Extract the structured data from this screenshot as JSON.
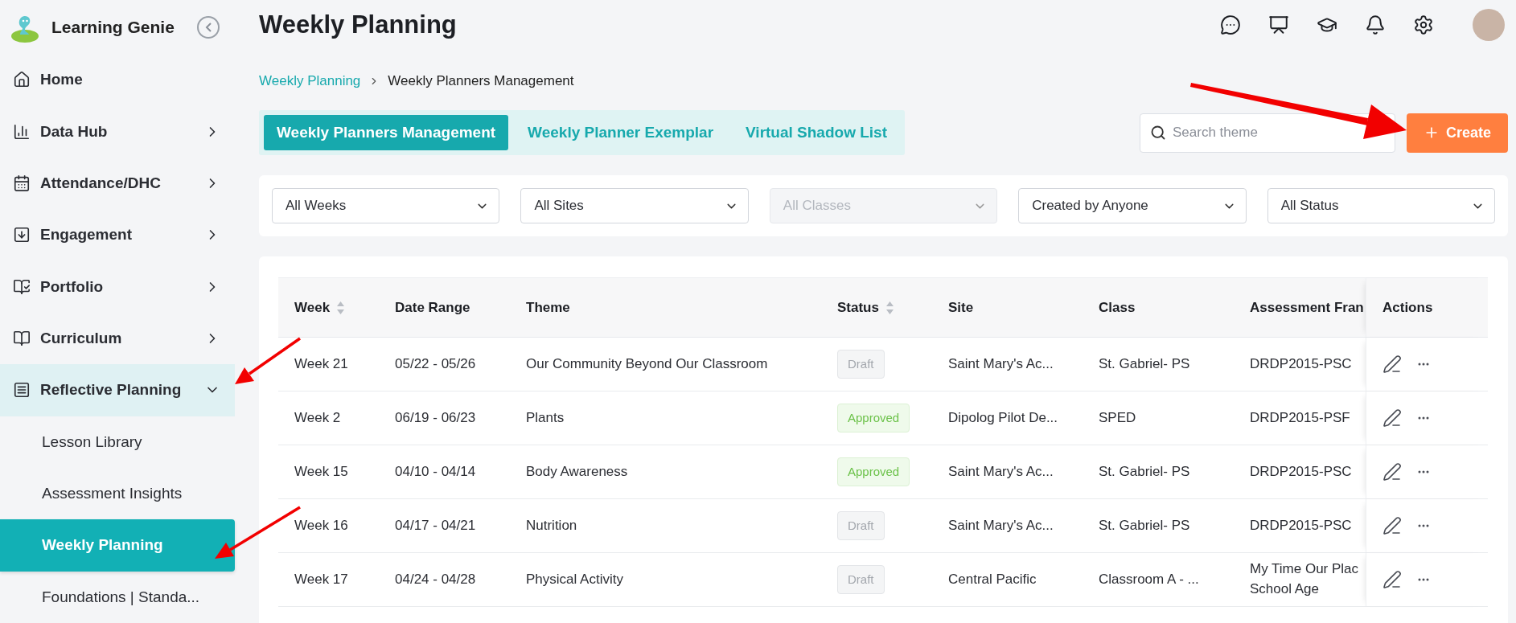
{
  "app": {
    "name": "Learning Genie"
  },
  "sidebar": {
    "items": [
      {
        "label": "Home",
        "kind": "link",
        "selected": false
      },
      {
        "label": "Data Hub",
        "kind": "group",
        "expanded": false
      },
      {
        "label": "Attendance/DHC",
        "kind": "group",
        "expanded": false
      },
      {
        "label": "Engagement",
        "kind": "group",
        "expanded": false
      },
      {
        "label": "Portfolio",
        "kind": "group",
        "expanded": false
      },
      {
        "label": "Curriculum",
        "kind": "group",
        "expanded": false
      },
      {
        "label": "Reflective Planning",
        "kind": "group",
        "expanded": true,
        "children": [
          {
            "label": "Lesson Library",
            "selected": false
          },
          {
            "label": "Assessment Insights",
            "selected": false
          },
          {
            "label": "Weekly Planning",
            "selected": true
          },
          {
            "label": "Foundations | Standa...",
            "selected": false
          }
        ]
      }
    ]
  },
  "page": {
    "title": "Weekly Planning"
  },
  "breadcrumb": [
    {
      "label": "Weekly Planning",
      "kind": "link"
    },
    {
      "label": "Weekly Planners Management",
      "kind": "current"
    }
  ],
  "tabs": [
    {
      "label": "Weekly Planners Management",
      "selected": true
    },
    {
      "label": "Weekly Planner Exemplar",
      "selected": false
    },
    {
      "label": "Virtual Shadow List",
      "selected": false
    }
  ],
  "search": {
    "placeholder": "Search theme"
  },
  "create_button": {
    "label": "Create"
  },
  "filters": [
    {
      "label": "All Weeks",
      "disabled": false
    },
    {
      "label": "All Sites",
      "disabled": false
    },
    {
      "label": "All Classes",
      "disabled": true
    },
    {
      "label": "Created by Anyone",
      "disabled": false
    },
    {
      "label": "All Status",
      "disabled": false
    }
  ],
  "table": {
    "columns": [
      {
        "label": "Week",
        "sortable": true
      },
      {
        "label": "Date Range",
        "sortable": false
      },
      {
        "label": "Theme",
        "sortable": false
      },
      {
        "label": "Status",
        "sortable": true
      },
      {
        "label": "Site",
        "sortable": false
      },
      {
        "label": "Class",
        "sortable": false
      },
      {
        "label": "Assessment Fran"
      },
      {
        "label": "Actions",
        "sortable": false
      }
    ],
    "rows": [
      {
        "week": "Week 21",
        "date_range": "05/22 - 05/26",
        "theme": "Our Community Beyond Our Classroom",
        "status": {
          "label": "Draft",
          "kind": "draft"
        },
        "site": "Saint Mary's Ac...",
        "class": "St. Gabriel- PS",
        "framework": "DRDP2015-PSC"
      },
      {
        "week": "Week 2",
        "date_range": "06/19 - 06/23",
        "theme": "Plants",
        "status": {
          "label": "Approved",
          "kind": "approved"
        },
        "site": "Dipolog Pilot De...",
        "class": "SPED",
        "framework": "DRDP2015-PSF"
      },
      {
        "week": "Week 15",
        "date_range": "04/10 - 04/14",
        "theme": "Body Awareness",
        "status": {
          "label": "Approved",
          "kind": "approved"
        },
        "site": "Saint Mary's Ac...",
        "class": "St. Gabriel- PS",
        "framework": "DRDP2015-PSC"
      },
      {
        "week": "Week 16",
        "date_range": "04/17 - 04/21",
        "theme": "Nutrition",
        "status": {
          "label": "Draft",
          "kind": "draft"
        },
        "site": "Saint Mary's Ac...",
        "class": "St. Gabriel- PS",
        "framework": "DRDP2015-PSC"
      },
      {
        "week": "Week 17",
        "date_range": "04/24 - 04/28",
        "theme": "Physical Activity",
        "status": {
          "label": "Draft",
          "kind": "draft"
        },
        "site": "Central Pacific",
        "class": "Classroom A - ...",
        "framework": "My Time Our Plac School Age"
      }
    ]
  }
}
